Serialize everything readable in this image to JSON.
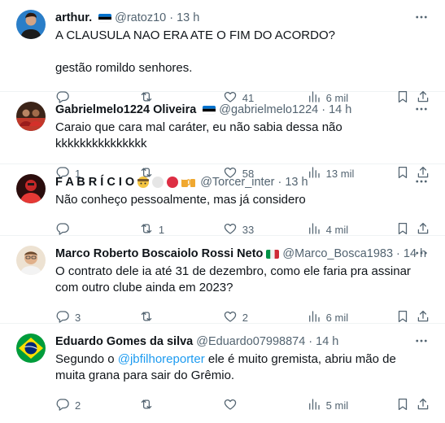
{
  "tweets": [
    {
      "name": "arthur.",
      "handle": "@ratoz10",
      "dot": "·",
      "time": "13 h",
      "lines": [
        "A CLAUSULA NAO ERA ATE O FIM DO ACORDO?",
        "gestão romildo senhores."
      ],
      "replies": "",
      "retweets": "",
      "likes": "41",
      "views": "6 mil"
    },
    {
      "name": "Gabrielmelo1224 Oliveira",
      "handle": "@gabrielmelo1224",
      "dot": "·",
      "time": "14 h",
      "lines": [
        "Caraio que cara mal caráter, eu não sabia dessa não kkkkkkkkkkkkkkk"
      ],
      "replies": "1",
      "retweets": "",
      "likes": "58",
      "views": "13 mil"
    },
    {
      "name": "F A B R Í C I O",
      "handle": "@Torcer_inter",
      "dot": "·",
      "time": "13 h",
      "lines": [
        "Não conheço pessoalmente, mas já considero"
      ],
      "replies": "",
      "retweets": "1",
      "likes": "33",
      "views": "4 mil"
    },
    {
      "name": "Marco Roberto Boscaiolo Rossi Neto",
      "handle": "@Marco_Bosca1983",
      "dot": "·",
      "time": "14 h",
      "lines": [
        "O contrato dele ia até 31 de dezembro, como ele faria pra assinar com outro clube ainda em 2023?"
      ],
      "replies": "3",
      "retweets": "",
      "likes": "2",
      "views": "6 mil"
    },
    {
      "name": "Eduardo Gomes da silva",
      "handle": "@Eduardo07998874",
      "dot": "·",
      "time": "14 h",
      "text_prefix": "Segundo o ",
      "mention": "@jbfilhoreporter",
      "text_suffix": " ele é muito gremista, abriu mão de muita grana para sair do Grêmio.",
      "replies": "2",
      "retweets": "",
      "likes": "",
      "views": "5 mil"
    }
  ],
  "icons": {
    "reply": "reply-icon",
    "retweet": "retweet-icon",
    "like": "heart-icon",
    "views": "views-chart-icon",
    "bookmark": "bookmark-icon",
    "share": "share-icon",
    "more": "more-dots-icon"
  },
  "colors": {
    "text": "#0f1419",
    "secondary": "#536471",
    "link": "#1d9bf0",
    "divider": "#eff3f4"
  }
}
